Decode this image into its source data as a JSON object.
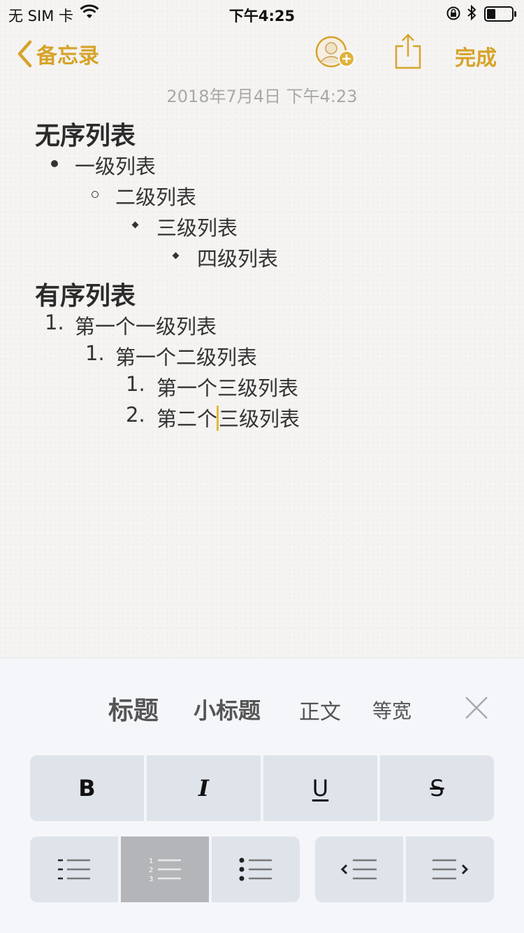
{
  "status_bar": {
    "carrier": "无 SIM 卡",
    "time": "下午4:25"
  },
  "nav": {
    "back_label": "备忘录",
    "done_label": "完成",
    "accent_color": "#d6a329"
  },
  "note": {
    "date": "2018年7月4日 下午4:23",
    "unordered_heading": "无序列表",
    "unordered_items": [
      "一级列表",
      "二级列表",
      "三级列表",
      "四级列表"
    ],
    "ordered_heading": "有序列表",
    "ordered_items": [
      {
        "number": "1.",
        "text": "第一个一级列表"
      },
      {
        "number": "1.",
        "text": "第一个二级列表"
      },
      {
        "number": "1.",
        "text": "第一个三级列表"
      },
      {
        "number": "2.",
        "text_before_caret": "第二个",
        "text_after_caret": "三级列表"
      }
    ]
  },
  "toolbar": {
    "styles": [
      "标题",
      "小标题",
      "正文",
      "等宽"
    ],
    "format_buttons": [
      "B",
      "I",
      "U",
      "S"
    ],
    "list_buttons": [
      "dashed-list-icon",
      "numbered-list-icon",
      "bulleted-list-icon"
    ],
    "indent_buttons": [
      "decrease-indent-icon",
      "increase-indent-icon"
    ],
    "active_list_button": "numbered-list-icon"
  }
}
